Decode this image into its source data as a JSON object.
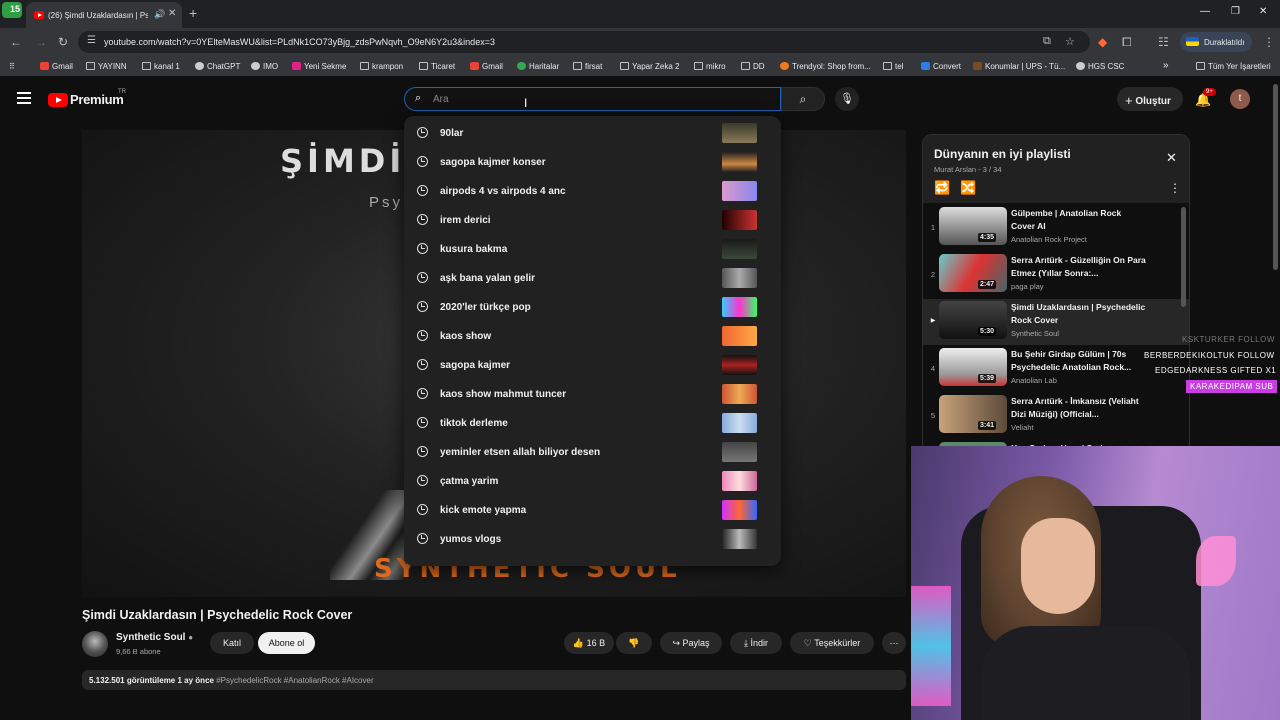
{
  "browser": {
    "tab_title": "(26) Şimdi Uzaklardasın | Psychedelic Rock Cover",
    "tab_badge": "15",
    "url": "youtube.com/watch?v=0YElteMasWU&list=PLdNk1CO73yBjg_zdsPwNqvh_O9eN6Y2u3&index=3",
    "paused_label": "Duraklatıldı",
    "bookmarks": [
      "Gmail",
      "YAYINN",
      "kanal 1",
      "ChatGPT",
      "IMO",
      "Yeni Sekme",
      "krampon",
      "Ticaret",
      "Gmail",
      "Haritalar",
      "firsat",
      "Yapar Zeka 2",
      "mikro",
      "DD",
      "Trendyol: Shop from...",
      "tel",
      "Convert",
      "Konumlar | UPS - Tü...",
      "HGS CSC"
    ],
    "bookmarks_more": "»",
    "all_bookmarks": "Tüm Yer İşaretleri"
  },
  "youtube": {
    "logo_text": "Premium",
    "region": "TR",
    "search_placeholder": "Ara",
    "create_label": "Oluştur",
    "notif_count": "9+",
    "avatar_letter": "t"
  },
  "suggestions": [
    "90lar",
    "sagopa kajmer konser",
    "airpods 4 vs airpods 4 anc",
    "irem derici",
    "kusura bakma",
    "aşk bana yalan gelir",
    "2020'ler türkçe pop",
    "kaos show",
    "sagopa kajmer",
    "kaos show mahmut tuncer",
    "tiktok derleme",
    "yeminler etsen allah biliyor desen",
    "çatma yarim",
    "kick emote yapma",
    "yumos vlogs"
  ],
  "video": {
    "overlay_title": "ŞİMDİ",
    "overlay_sub": "Psy",
    "overlay_brand": "SYNTHETIC SOUL",
    "title": "Şimdi Uzaklardasın | Psychedelic Rock Cover",
    "channel": "Synthetic Soul",
    "subscribers": "9,66 B abone",
    "join_label": "Katıl",
    "subscribe_label": "Abone ol",
    "likes": "16 B",
    "share_label": "Paylaş",
    "download_label": "İndir",
    "thanks_label": "Teşekkürler",
    "views": "5.132.501 görüntüleme",
    "age": "1 ay önce",
    "tags": "#PsychedelicRock #AnatolianRock #AIcover"
  },
  "playlist": {
    "title": "Dünyanın en iyi playlisti",
    "subtitle": "Murat Arslan - 3 / 34",
    "items": [
      {
        "index": "1",
        "title": "Gülpembe | Anatolian Rock Cover AI",
        "channel": "Anatolian Rock Project",
        "duration": "4:35"
      },
      {
        "index": "2",
        "title": "Serra Arıtürk - Güzelliğin On Para Etmez (Yıllar Sonra:...",
        "channel": "paga play",
        "duration": "2:47"
      },
      {
        "index": "▶",
        "title": "Şimdi Uzaklardasın | Psychedelic Rock Cover",
        "channel": "Synthetic Soul",
        "duration": "5:30"
      },
      {
        "index": "4",
        "title": "Bu Şehir Girdap Gülüm | 70s Psychedelic Anatolian Rock...",
        "channel": "Anatolian Lab",
        "duration": "5:39"
      },
      {
        "index": "5",
        "title": "Serra Arıtürk - İmkansız (Veliaht Dizi Müziği) (Official...",
        "channel": "Veliaht",
        "duration": "3:41"
      },
      {
        "index": "",
        "title": "Han Sarbos Hangi Sarbos",
        "channel": "",
        "duration": ""
      }
    ]
  },
  "stream_overlay": {
    "line1": "KSKTURKER FOLLOW",
    "line2": "BERBERDEKIKOLTUK FOLLOW",
    "line3": "EDGEDARKNESS GIFTED X1",
    "line4": "KARAKEDIPAM SUB"
  }
}
